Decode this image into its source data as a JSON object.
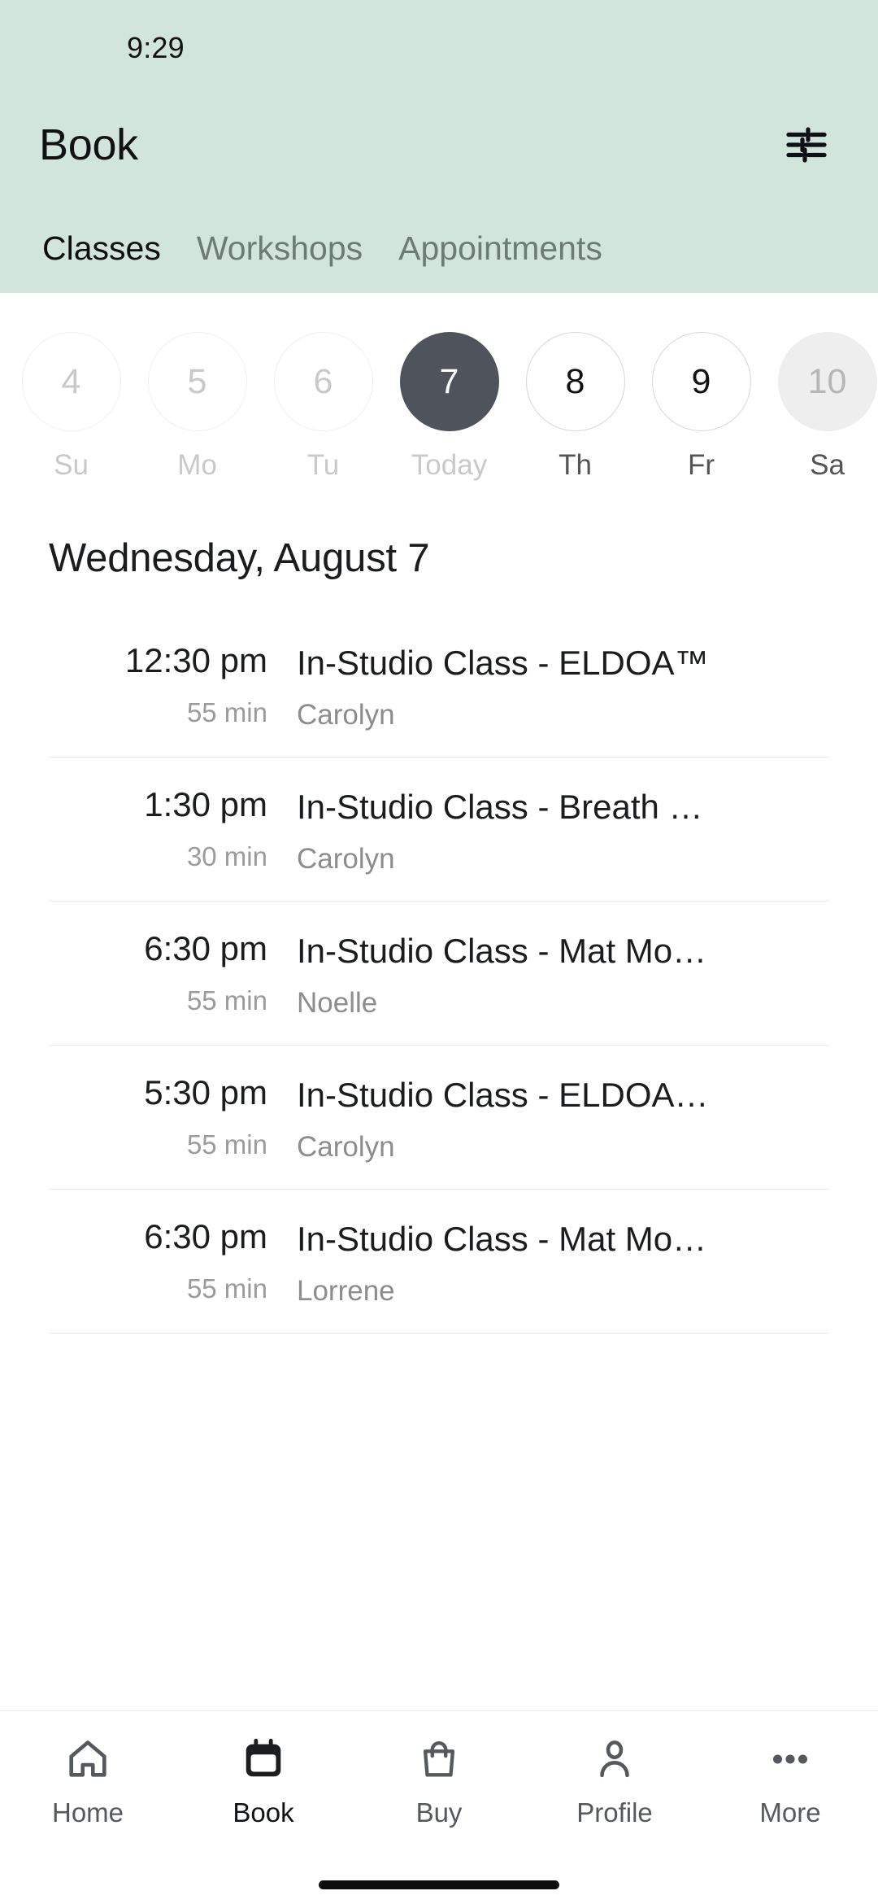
{
  "status_bar": {
    "time": "9:29"
  },
  "header": {
    "title": "Book",
    "filter_icon": "tune-filter-icon",
    "background_color": "#d2e5dd",
    "tabs": [
      {
        "label": "Classes",
        "active": true
      },
      {
        "label": "Workshops",
        "active": false
      },
      {
        "label": "Appointments",
        "active": false
      }
    ]
  },
  "date_strip": {
    "days": [
      {
        "number": "4",
        "weekday": "Su",
        "state": "past"
      },
      {
        "number": "5",
        "weekday": "Mo",
        "state": "past"
      },
      {
        "number": "6",
        "weekday": "Tu",
        "state": "past"
      },
      {
        "number": "7",
        "weekday": "Today",
        "state": "today"
      },
      {
        "number": "8",
        "weekday": "Th",
        "state": "future"
      },
      {
        "number": "9",
        "weekday": "Fr",
        "state": "future"
      },
      {
        "number": "10",
        "weekday": "Sa",
        "state": "disabled"
      }
    ],
    "selected_color": "#4e535c"
  },
  "day_heading": "Wednesday, August 7",
  "classes": [
    {
      "time": "12:30 pm",
      "duration": "55 min",
      "title": "In-Studio Class - ELDOA™",
      "teacher": "Carolyn"
    },
    {
      "time": "1:30 pm",
      "duration": "30 min",
      "title": "In-Studio Class - Breath …",
      "teacher": "Carolyn"
    },
    {
      "time": "6:30 pm",
      "duration": "55 min",
      "title": "In-Studio Class - Mat Mo…",
      "teacher": "Noelle"
    },
    {
      "time": "5:30 pm",
      "duration": "55 min",
      "title": "In-Studio Class - ELDOA…",
      "teacher": "Carolyn"
    },
    {
      "time": "6:30 pm",
      "duration": "55 min",
      "title": "In-Studio Class - Mat Mo…",
      "teacher": "Lorrene"
    }
  ],
  "bottom_nav": {
    "items": [
      {
        "label": "Home",
        "icon": "home-icon",
        "active": false
      },
      {
        "label": "Book",
        "icon": "calendar-icon",
        "active": true
      },
      {
        "label": "Buy",
        "icon": "bag-icon",
        "active": false
      },
      {
        "label": "Profile",
        "icon": "person-icon",
        "active": false
      },
      {
        "label": "More",
        "icon": "ellipsis-icon",
        "active": false
      }
    ]
  }
}
